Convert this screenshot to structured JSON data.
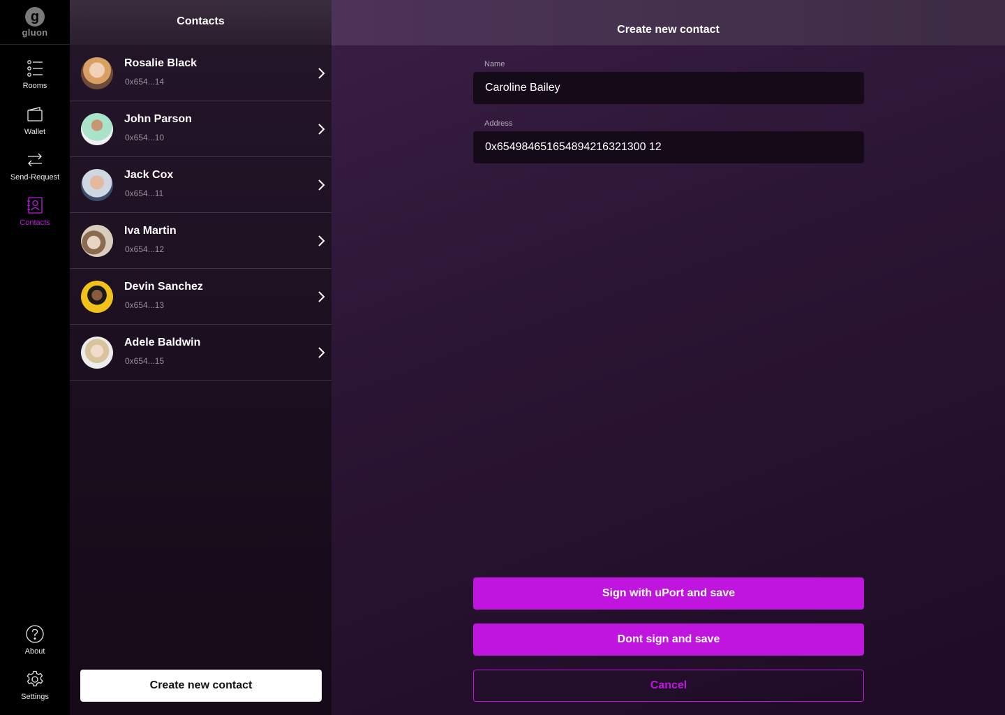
{
  "app": {
    "logo_letter": "g",
    "logo_word": "gluon"
  },
  "nav": {
    "items": [
      {
        "label": "Rooms",
        "icon": "list-icon",
        "active": false
      },
      {
        "label": "Wallet",
        "icon": "wallet-icon",
        "active": false
      },
      {
        "label": "Send-Request",
        "icon": "transfer-icon",
        "active": false
      },
      {
        "label": "Contacts",
        "icon": "contacts-icon",
        "active": true
      }
    ],
    "bottom": [
      {
        "label": "About",
        "icon": "help-icon"
      },
      {
        "label": "Settings",
        "icon": "gear-icon"
      }
    ]
  },
  "contacts": {
    "title": "Contacts",
    "list": [
      {
        "name": "Rosalie Black",
        "address": "0x654...14"
      },
      {
        "name": "John Parson",
        "address": "0x654...10"
      },
      {
        "name": "Jack Cox",
        "address": "0x654...11"
      },
      {
        "name": "Iva Martin",
        "address": "0x654...12"
      },
      {
        "name": "Devin Sanchez",
        "address": "0x654...13"
      },
      {
        "name": "Adele Baldwin",
        "address": "0x654...15"
      }
    ],
    "create_label": "Create new contact"
  },
  "form": {
    "title": "Create new contact",
    "name_label": "Name",
    "name_value": "Caroline Bailey",
    "address_label": "Address",
    "address_value": "0x654984651654894216321300 12",
    "sign_label": "Sign with uPort and save",
    "nosign_label": "Dont sign and save",
    "cancel_label": "Cancel"
  },
  "colors": {
    "accent": "#c015de",
    "nav_active": "#c21ae0"
  }
}
